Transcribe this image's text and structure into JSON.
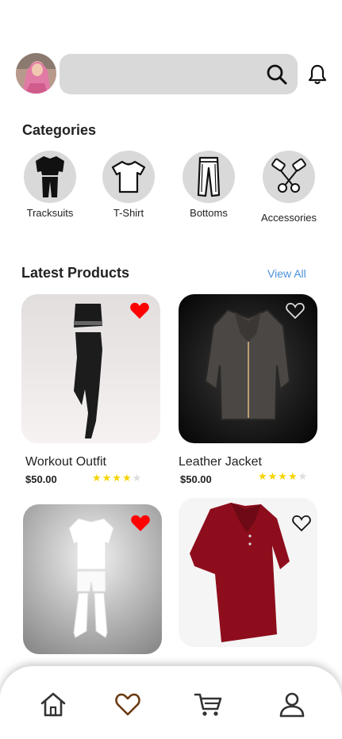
{
  "header": {
    "search_placeholder": "",
    "avatar_icon": "user-photo",
    "search_icon": "search-icon",
    "notification_icon": "bell-icon"
  },
  "categories": {
    "title": "Categories",
    "items": [
      {
        "label": "Tracksuits",
        "icon": "tracksuit-icon"
      },
      {
        "label": "T-Shirt",
        "icon": "tshirt-icon"
      },
      {
        "label": "Bottoms",
        "icon": "pants-icon"
      },
      {
        "label": "Accessories",
        "icon": "accessories-icon"
      }
    ]
  },
  "latest": {
    "title": "Latest Products",
    "view_all": "View All",
    "products": [
      {
        "name": "Workout Outfit",
        "price": "$50.00",
        "rating": 4,
        "favorite": true
      },
      {
        "name": "Leather Jacket",
        "price": "$50.00",
        "rating": 4,
        "favorite": false
      },
      {
        "name": "",
        "price": "",
        "favorite": true
      },
      {
        "name": "",
        "price": "",
        "favorite": false
      }
    ]
  },
  "bottom_nav": {
    "items": [
      {
        "icon": "home-icon"
      },
      {
        "icon": "heart-icon",
        "active": true
      },
      {
        "icon": "cart-icon"
      },
      {
        "icon": "profile-icon"
      }
    ]
  },
  "colors": {
    "accent_link": "#4a90d9",
    "favorite_red": "#ff0000",
    "active_nav": "#6b3a10",
    "star": "#f5d400",
    "chip_bg": "#d9d9d9"
  }
}
